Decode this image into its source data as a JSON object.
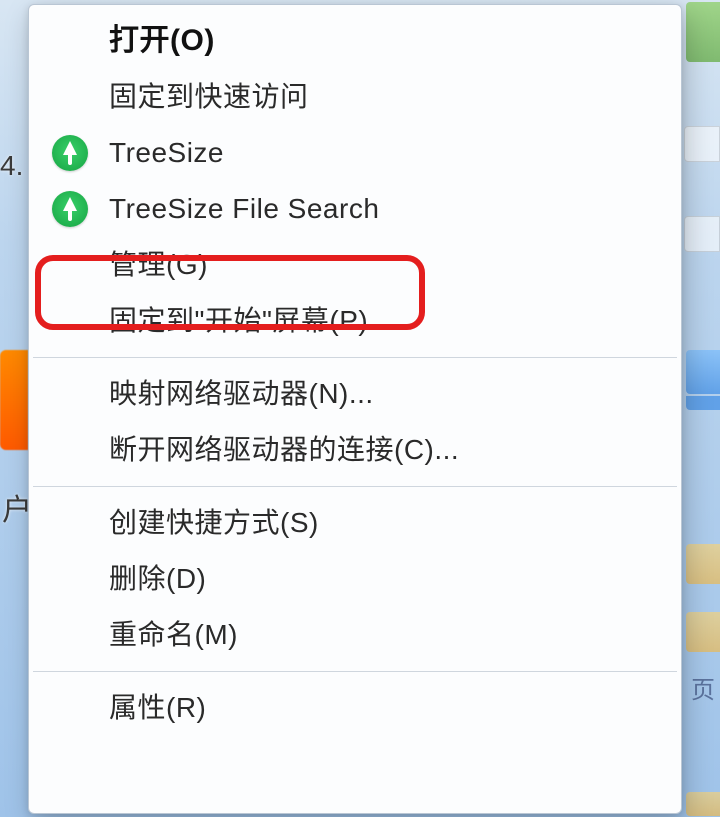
{
  "highlight_color": "#e41e1e",
  "treesize_icon_color": "#20b14e",
  "context_menu": {
    "items": [
      {
        "label": "打开(O)",
        "bold": true,
        "icon": null
      },
      {
        "label": "固定到快速访问",
        "icon": null
      },
      {
        "label": "TreeSize",
        "icon": "treesize-icon"
      },
      {
        "label": "TreeSize File Search",
        "icon": "treesize-icon"
      },
      {
        "label": "管理(G)",
        "icon": null,
        "highlighted": true
      },
      {
        "label": "固定到\"开始\"屏幕(P)",
        "icon": null
      }
    ],
    "group2": [
      {
        "label": "映射网络驱动器(N)..."
      },
      {
        "label": "断开网络驱动器的连接(C)..."
      }
    ],
    "group3": [
      {
        "label": "创建快捷方式(S)"
      },
      {
        "label": "删除(D)"
      },
      {
        "label": "重命名(M)"
      }
    ],
    "group4": [
      {
        "label": "属性(R)"
      }
    ]
  },
  "sidebar_left_text": {
    "frag1": "4.",
    "frag2": "户"
  },
  "sidebar_right_text": {
    "frag": "页"
  }
}
